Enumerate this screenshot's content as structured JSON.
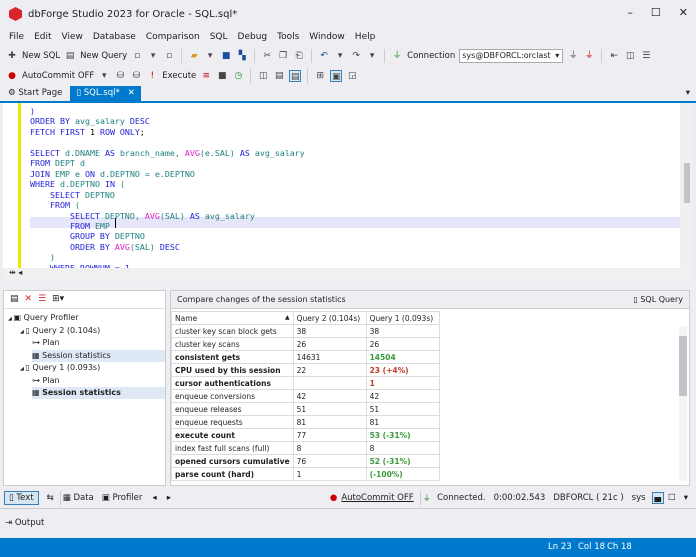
{
  "window": {
    "title": "dbForge Studio 2023 for Oracle - SQL.sql*",
    "logo_letter": "S"
  },
  "menu": [
    "File",
    "Edit",
    "View",
    "Database",
    "Comparison",
    "SQL",
    "Debug",
    "Tools",
    "Window",
    "Help"
  ],
  "toolbar1": {
    "new_sql": "New SQL",
    "new_query": "New Query",
    "connection_label": "Connection",
    "connection_value": "sys@DBFORCL:orclast"
  },
  "toolbar2": {
    "autocommit": "AutoCommit OFF",
    "execute": "Execute"
  },
  "tabs": [
    {
      "label": "Start Page",
      "active": false
    },
    {
      "label": "SQL.sql*",
      "active": true
    }
  ],
  "editor": {
    "lines": [
      [
        [
          "kw",
          ")"
        ]
      ],
      [
        [
          "kw",
          "ORDER BY "
        ],
        [
          "id",
          "avg_salary "
        ],
        [
          "kw",
          "DESC"
        ]
      ],
      [
        [
          "kw",
          "FETCH FIRST "
        ],
        [
          "num",
          "1"
        ],
        [
          "kw",
          " ROW ONLY"
        ],
        [
          "num",
          ";"
        ]
      ],
      [],
      [
        [
          "kw",
          "SELECT "
        ],
        [
          "id",
          "d.DNAME "
        ],
        [
          "kw",
          "AS "
        ],
        [
          "id",
          "branch_name, "
        ],
        [
          "fn",
          "AVG"
        ],
        [
          "id",
          "(e.SAL) "
        ],
        [
          "kw",
          "AS "
        ],
        [
          "id",
          "avg_salary"
        ]
      ],
      [
        [
          "kw",
          "FROM "
        ],
        [
          "id",
          "DEPT d"
        ]
      ],
      [
        [
          "kw",
          "JOIN "
        ],
        [
          "id",
          "EMP e "
        ],
        [
          "kw",
          "ON "
        ],
        [
          "id",
          "d.DEPTNO = e.DEPTNO"
        ]
      ],
      [
        [
          "kw",
          "WHERE "
        ],
        [
          "id",
          "d.DEPTNO "
        ],
        [
          "kw",
          "IN "
        ],
        [
          "id",
          "("
        ]
      ],
      [
        [
          "kw",
          "    SELECT "
        ],
        [
          "id",
          "DEPTNO"
        ]
      ],
      [
        [
          "kw",
          "    FROM "
        ],
        [
          "id",
          "("
        ]
      ],
      [
        [
          "kw",
          "        SELECT "
        ],
        [
          "id",
          "DEPTNO, "
        ],
        [
          "fn",
          "AVG"
        ],
        [
          "id",
          "(SAL) "
        ],
        [
          "kw",
          "AS "
        ],
        [
          "id",
          "avg_salary"
        ]
      ],
      [
        [
          "kw",
          "        FROM "
        ],
        [
          "id",
          "EMP "
        ]
      ],
      [
        [
          "kw",
          "        GROUP BY "
        ],
        [
          "id",
          "DEPTNO"
        ]
      ],
      [
        [
          "kw",
          "        ORDER BY "
        ],
        [
          "fn",
          "AVG"
        ],
        [
          "id",
          "(SAL) "
        ],
        [
          "kw",
          "DESC"
        ]
      ],
      [
        [
          "id",
          "    )"
        ]
      ],
      [
        [
          "kw",
          "    WHERE ROWNUM = 1"
        ]
      ]
    ]
  },
  "profiler_tree": [
    {
      "label": "Query Profiler",
      "level": 0
    },
    {
      "label": "Query 2 (0.104s)",
      "level": 1
    },
    {
      "label": "Plan",
      "level": 2
    },
    {
      "label": "Session statistics",
      "level": 2,
      "selected": true
    },
    {
      "label": "Query 1 (0.093s)",
      "level": 1
    },
    {
      "label": "Plan",
      "level": 2
    },
    {
      "label": "Session statistics",
      "level": 2,
      "bold": true,
      "selected": true
    }
  ],
  "stats": {
    "title": "Compare changes of the session statistics",
    "sql_query_button": "SQL Query",
    "columns": [
      "Name",
      "Query 2 (0.104s)",
      "Query 1 (0.093s)"
    ],
    "rows": [
      {
        "name": "cluster key scan block gets",
        "q2": "38",
        "q1": "38",
        "bold": false,
        "change": ""
      },
      {
        "name": "cluster key scans",
        "q2": "26",
        "q1": "26",
        "bold": false,
        "change": ""
      },
      {
        "name": "consistent gets",
        "q2": "14631",
        "q1": "14504",
        "bold": true,
        "change": "better"
      },
      {
        "name": "CPU used by this session",
        "q2": "22",
        "q1": "23 (+4%)",
        "bold": true,
        "change": "worse"
      },
      {
        "name": "cursor authentications",
        "q2": "",
        "q1": "1",
        "bold": true,
        "change": "worse"
      },
      {
        "name": "enqueue conversions",
        "q2": "42",
        "q1": "42",
        "bold": false,
        "change": ""
      },
      {
        "name": "enqueue releases",
        "q2": "51",
        "q1": "51",
        "bold": false,
        "change": ""
      },
      {
        "name": "enqueue requests",
        "q2": "81",
        "q1": "81",
        "bold": false,
        "change": ""
      },
      {
        "name": "execute count",
        "q2": "77",
        "q1": "53 (-31%)",
        "bold": true,
        "change": "better"
      },
      {
        "name": "index fast full scans (full)",
        "q2": "8",
        "q1": "8",
        "bold": false,
        "change": ""
      },
      {
        "name": "opened cursors cumulative",
        "q2": "76",
        "q1": "52 (-31%)",
        "bold": true,
        "change": "better"
      },
      {
        "name": "parse count (hard)",
        "q2": "1",
        "q1": " (-100%)",
        "bold": true,
        "change": "better"
      }
    ]
  },
  "bottom_toolbar": {
    "text": "Text",
    "data": "Data",
    "profiler": "Profiler",
    "autocommit": "AutoCommit OFF",
    "connected": "Connected.",
    "elapsed": "0:00:02.543",
    "db": "DBFORCL ( 21c )",
    "user": "sys"
  },
  "output_label": "Output",
  "statusbar": {
    "ln": "Ln 23",
    "col": "Col 18",
    "ch": "Ch 18"
  },
  "colors": {
    "accent": "#007acc",
    "better": "#3a9a3a",
    "worse": "#c0392b"
  }
}
